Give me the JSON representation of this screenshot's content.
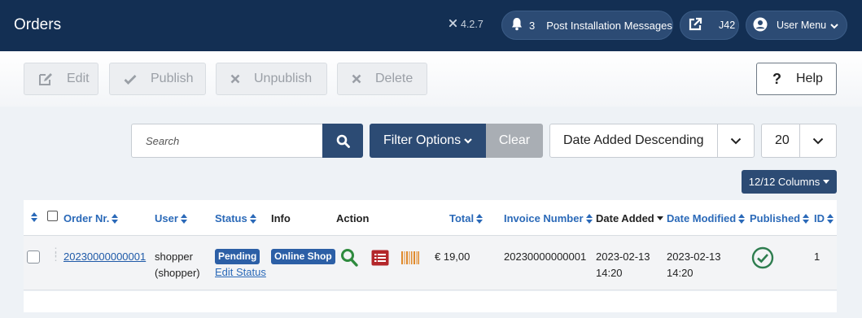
{
  "header": {
    "title": "Orders",
    "version": "4.2.7",
    "messages": {
      "count": "3",
      "label": "Post Installation Messages"
    },
    "site": {
      "label": "J42"
    },
    "user_menu": {
      "label": "User Menu"
    }
  },
  "toolbar": {
    "edit": "Edit",
    "publish": "Publish",
    "unpublish": "Unpublish",
    "delete": "Delete",
    "help": "Help"
  },
  "filters": {
    "search_placeholder": "Search",
    "filter_options": "Filter Options",
    "clear": "Clear",
    "sort": "Date Added Descending",
    "limit": "20",
    "columns": "12/12 Columns"
  },
  "table": {
    "headers": {
      "order_nr": "Order Nr.",
      "user": "User",
      "status": "Status",
      "info": "Info",
      "action": "Action",
      "total": "Total",
      "invoice": "Invoice Number",
      "date_added": "Date Added",
      "date_modified": "Date Modified",
      "published": "Published",
      "id": "ID"
    },
    "rows": [
      {
        "order_nr": "20230000000001",
        "user_line1": "shopper",
        "user_line2": "(shopper)",
        "status": "Pending",
        "edit_status": "Edit Status",
        "info": "Online Shop",
        "total": "€ 19,00",
        "invoice": "20230000000001",
        "date_added_date": "2023-02-13",
        "date_added_time": "14:20",
        "date_modified_date": "2023-02-13",
        "date_modified_time": "14:20",
        "id": "1"
      }
    ]
  },
  "colors": {
    "header_bg": "#132f53",
    "primary": "#2c4b74",
    "link": "#2a69b8",
    "badge": "#2c5fa6",
    "published": "#2e7d4f",
    "action_search": "#2e8a3e",
    "action_list": "#b3262a",
    "action_barcode": "#e08a2c"
  },
  "icons": {
    "version": "joomla-icon",
    "messages": "bell-icon",
    "site": "external-link-icon",
    "user": "user-circle-icon",
    "search": "search-icon",
    "published": "check-circle-icon"
  }
}
